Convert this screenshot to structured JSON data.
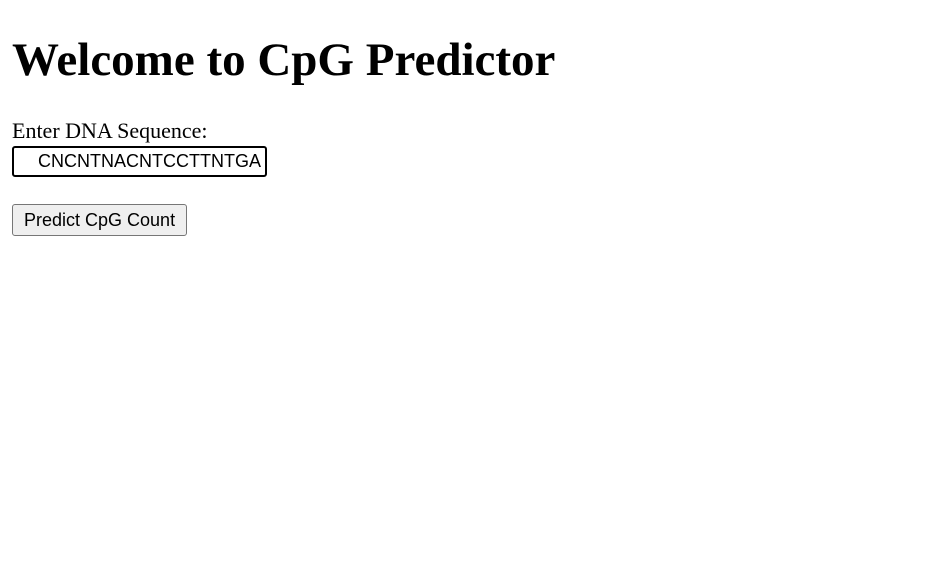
{
  "page": {
    "title": "Welcome to CpG Predictor"
  },
  "form": {
    "sequence_label": "Enter DNA Sequence:",
    "sequence_value": "CNCNTNACNTCCTTNTGA",
    "predict_button_label": "Predict CpG Count"
  }
}
